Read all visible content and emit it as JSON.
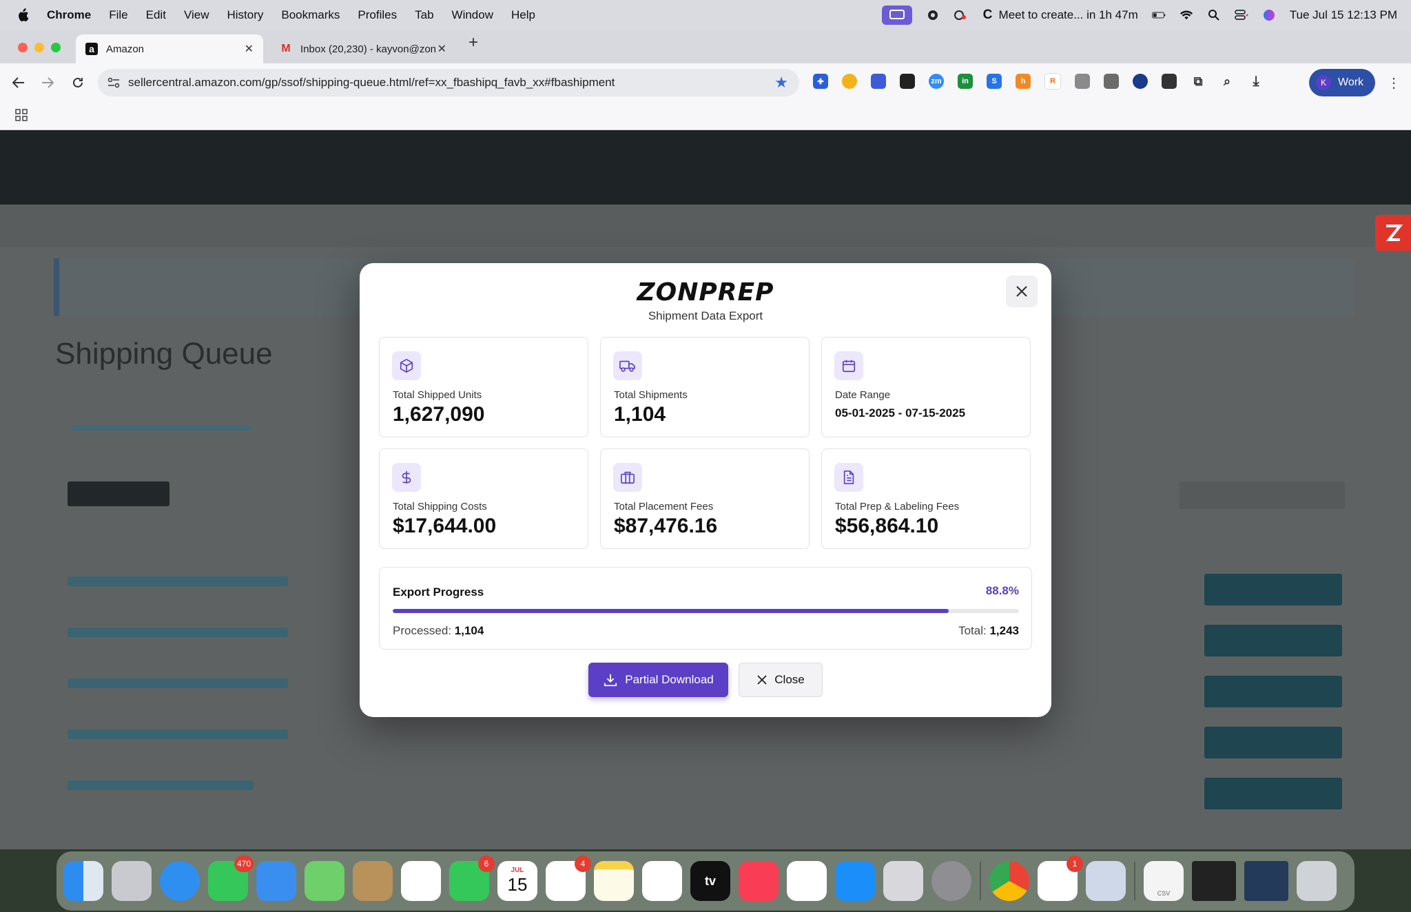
{
  "menubar": {
    "app": "Chrome",
    "items": [
      "File",
      "Edit",
      "View",
      "History",
      "Bookmarks",
      "Profiles",
      "Tab",
      "Window",
      "Help"
    ],
    "meeting": "Meet to create... in 1h 47m",
    "clock": "Tue Jul 15  12:13 PM"
  },
  "browser": {
    "tabs": [
      {
        "title": "Amazon",
        "favicon": "a"
      },
      {
        "title": "Inbox (20,230) - kayvon@zon",
        "favicon": "M"
      }
    ],
    "url": "sellercentral.amazon.com/gp/ssof/shipping-queue.html/ref=xx_fbashipq_favb_xx#fbashipment",
    "profile": {
      "initial": "K",
      "label": "Work"
    }
  },
  "background_page": {
    "heading": "Shipping Queue"
  },
  "modal": {
    "brand": "ZONPREP",
    "subtitle": "Shipment Data Export",
    "stats": [
      {
        "icon": "box-icon",
        "label": "Total Shipped Units",
        "value": "1,627,090"
      },
      {
        "icon": "truck-icon",
        "label": "Total Shipments",
        "value": "1,104"
      },
      {
        "icon": "calendar-icon",
        "label": "Date Range",
        "value": "05-01-2025 - 07-15-2025"
      },
      {
        "icon": "dollar-icon",
        "label": "Total Shipping Costs",
        "value": "$17,644.00"
      },
      {
        "icon": "briefcase-icon",
        "label": "Total Placement Fees",
        "value": "$87,476.16"
      },
      {
        "icon": "document-icon",
        "label": "Total Prep & Labeling Fees",
        "value": "$56,864.10"
      }
    ],
    "progress": {
      "title": "Export Progress",
      "percent_label": "88.8%",
      "fraction": 0.888,
      "processed_label": "Processed:",
      "processed_value": "1,104",
      "total_label": "Total:",
      "total_value": "1,243"
    },
    "buttons": {
      "download": "Partial Download",
      "close": "Close"
    }
  },
  "dock": {
    "badges": {
      "messages": "470",
      "facetime": "6",
      "reminders": "4",
      "slack": "1"
    },
    "calendar": {
      "month": "JUL",
      "day": "15"
    },
    "file_label": "CSV",
    "tv_label": "tv"
  },
  "colors": {
    "accent": "#5b3fc7",
    "icon_bg": "#ece7fb"
  }
}
